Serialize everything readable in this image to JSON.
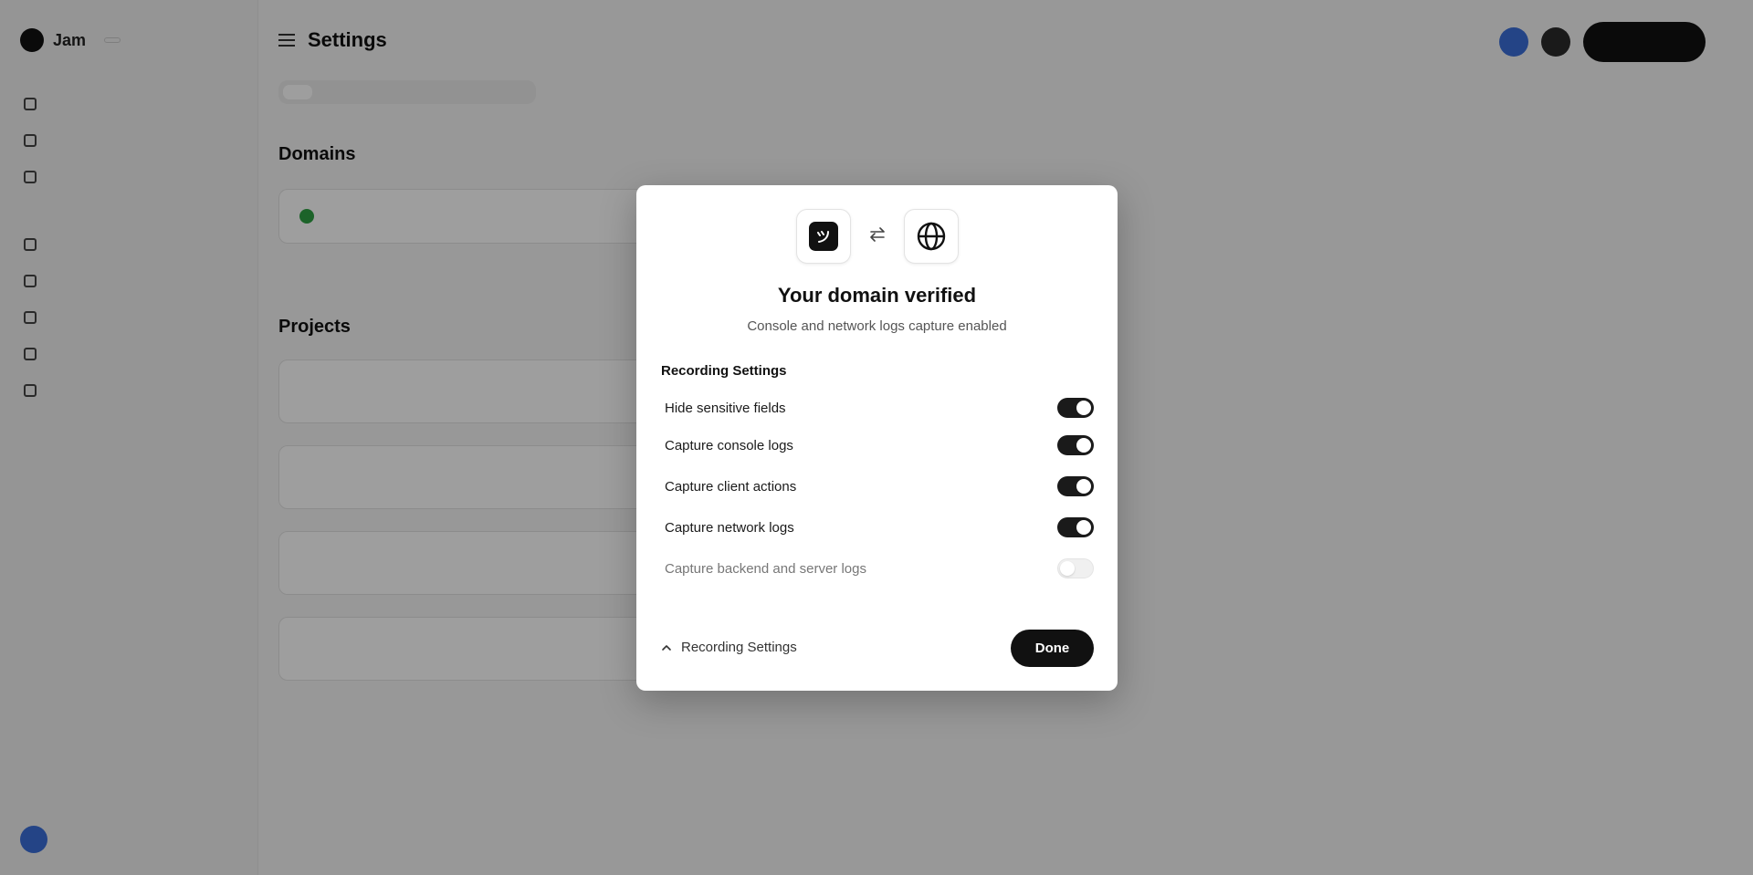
{
  "background": {
    "brand": {
      "name": "Jam",
      "badge": ""
    },
    "nav_sections": [
      {
        "heading": "",
        "items": [
          "",
          "",
          ""
        ]
      },
      {
        "heading": "",
        "items": [
          "",
          "",
          "",
          "",
          ""
        ]
      }
    ],
    "user": {
      "name": "",
      "email": ""
    },
    "page": {
      "title": "Settings",
      "subtitle": ""
    },
    "upgrade_label": "",
    "tabs": [
      "",
      "",
      "",
      "",
      "",
      "",
      ""
    ],
    "domains_section": {
      "title": "Domains",
      "subtitle": ""
    },
    "projects_section": {
      "title": "Projects",
      "subtitle": ""
    }
  },
  "modal": {
    "icons": {
      "left": "app-logo-icon",
      "middle": "swap-arrows-icon",
      "right": "globe-icon"
    },
    "title": "Your domain verified",
    "subtitle": "Console and network logs capture enabled",
    "settings_heading": "Recording Settings",
    "settings": [
      {
        "label": "Hide sensitive fields",
        "enabled": true,
        "disabled": false
      },
      {
        "label": "Capture console logs",
        "enabled": true,
        "disabled": false
      },
      {
        "label": "Capture client actions",
        "enabled": true,
        "disabled": false
      },
      {
        "label": "Capture network logs",
        "enabled": true,
        "disabled": false
      },
      {
        "label": "Capture backend and server logs",
        "enabled": false,
        "disabled": true
      }
    ],
    "footer_toggle_label": "Recording Settings",
    "done_label": "Done"
  },
  "colors": {
    "primary": "#111111",
    "overlay": "rgba(0,0,0,0.38)",
    "toggle_off": "#f0f0f0"
  }
}
